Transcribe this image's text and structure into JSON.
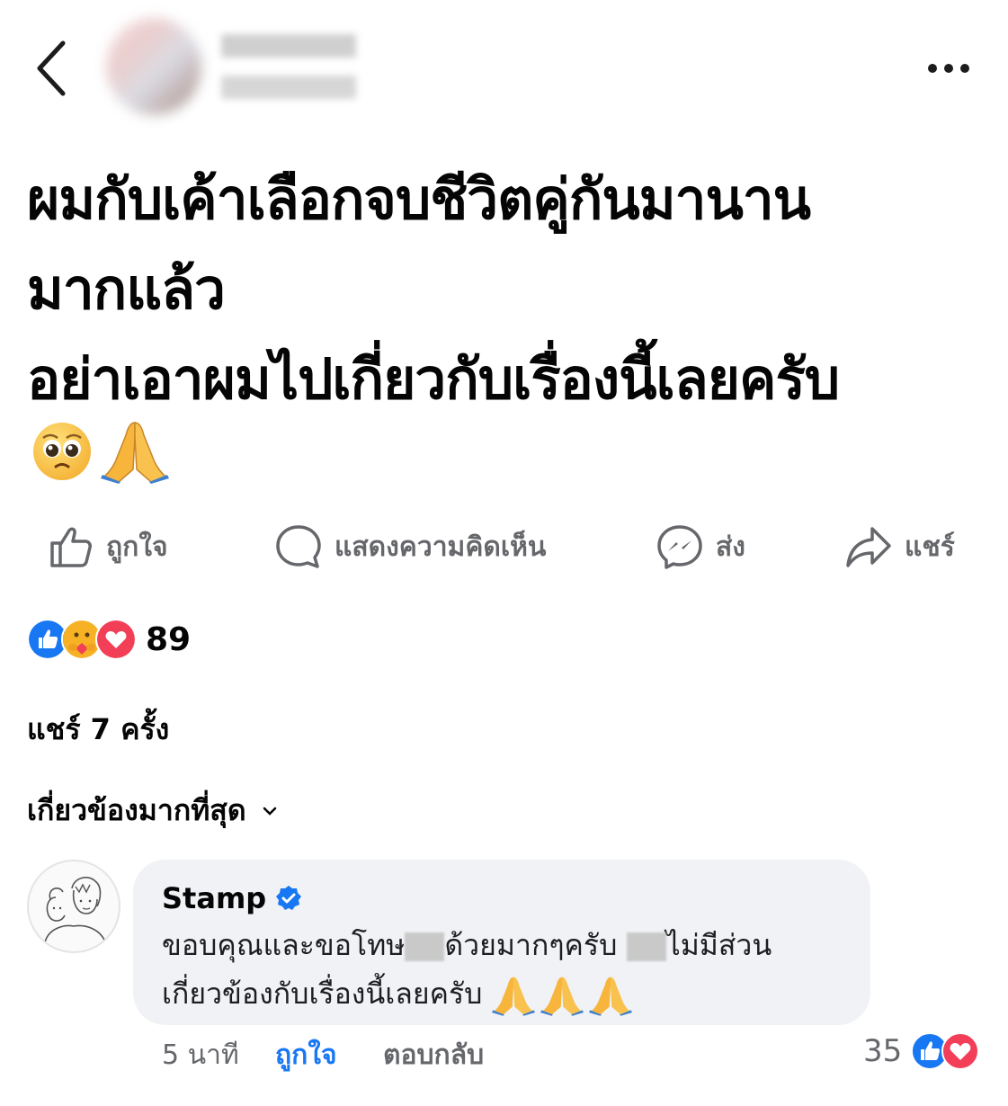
{
  "header": {
    "back_icon": "chevron-left-icon",
    "more_icon": "more-horizontal-icon"
  },
  "post": {
    "text": "ผมกับเค้าเลือกจบชีวิตคู่กันมานาน\nมากแล้ว\nอย่าเอาผมไปเกี่ยวกับเรื่องนี้เลยครับ",
    "emojis": [
      "pleading-face-emoji",
      "folded-hands-emoji"
    ]
  },
  "actions": {
    "like_label": "ถูกใจ",
    "comment_label": "แสดงความคิดเห็น",
    "send_label": "ส่ง",
    "share_label": "แชร์"
  },
  "reactions": {
    "types": [
      "like",
      "care",
      "love"
    ],
    "count": "89"
  },
  "shares_text": "แชร์ 7 ครั้ง",
  "sort_label": "เกี่ยวข้องมากที่สุด",
  "comment": {
    "author": "Stamp",
    "verified": true,
    "text_part1": "ขอบคุณและขอโทษ",
    "text_part2": "ด้วยมากๆครับ ",
    "text_part3": "ไม่มีส่วน",
    "text_part4": "เกี่ยวข้องกับเรื่องนี้เลยครับ ",
    "text_emojis": [
      "folded-hands-emoji",
      "folded-hands-emoji",
      "folded-hands-emoji"
    ],
    "time": "5 นาที",
    "like_label": "ถูกใจ",
    "reply_label": "ตอบกลับ",
    "reaction_count": "35",
    "reaction_types": [
      "like",
      "love"
    ]
  },
  "colors": {
    "facebook_blue": "#1877f2",
    "love_red": "#f33e58",
    "care_yellow": "#f7b125",
    "muted_text": "#65676b",
    "bubble_bg": "#f0f2f5"
  }
}
